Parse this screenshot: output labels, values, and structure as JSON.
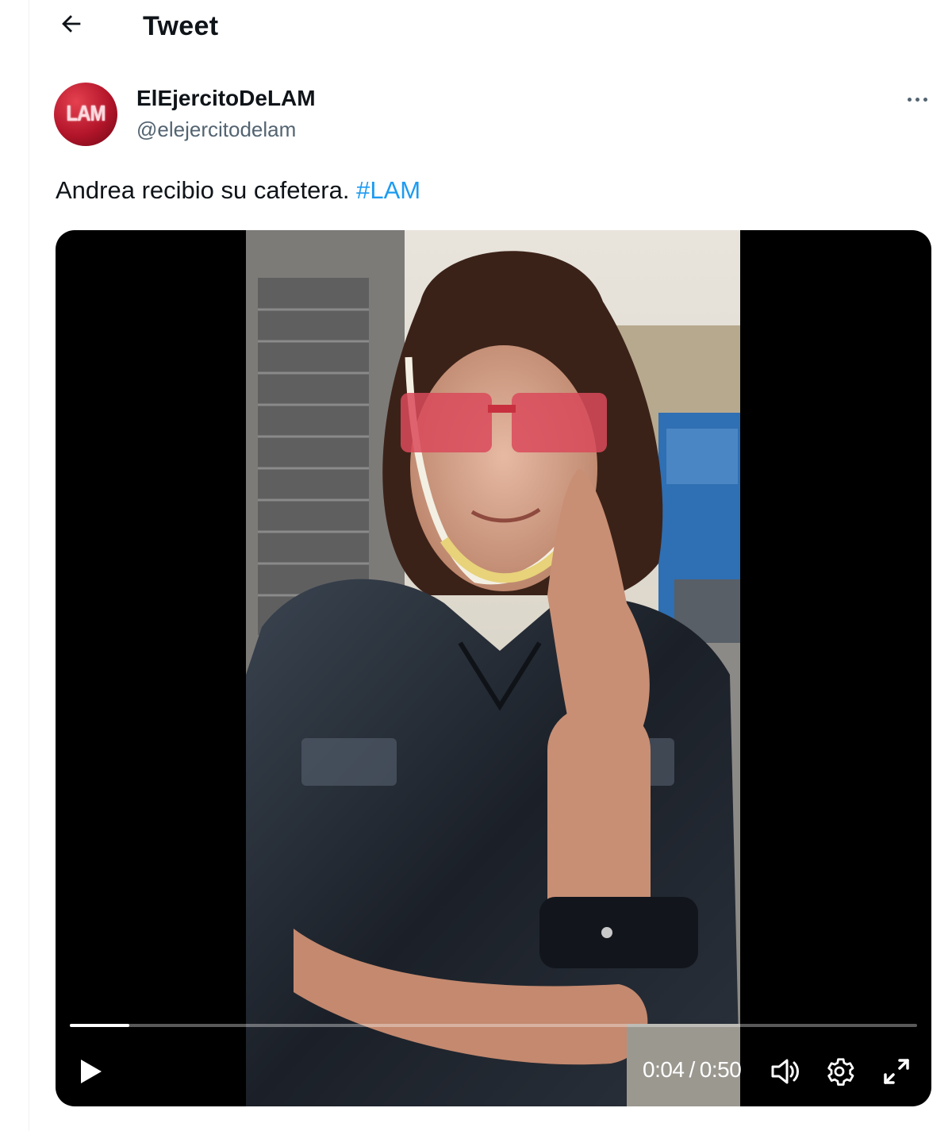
{
  "header": {
    "title": "Tweet",
    "back_icon": "arrow-left-icon"
  },
  "author": {
    "display_name": "ElEjercitoDeLAM",
    "handle": "@elejercitodelam",
    "avatar_text": "LAM",
    "avatar_color": "#c01a2f"
  },
  "tweet": {
    "text": "Andrea recibio su cafetera. ",
    "hashtag": "#LAM",
    "hashtag_color": "#1d9bf0"
  },
  "video": {
    "current_time": "0:04",
    "separator": "/",
    "duration": "0:50",
    "progress_fraction": 0.07,
    "controls": [
      "play-icon",
      "volume-icon",
      "settings-gear-icon",
      "fullscreen-icon"
    ]
  },
  "menu_icon": "more-horizontal-icon"
}
